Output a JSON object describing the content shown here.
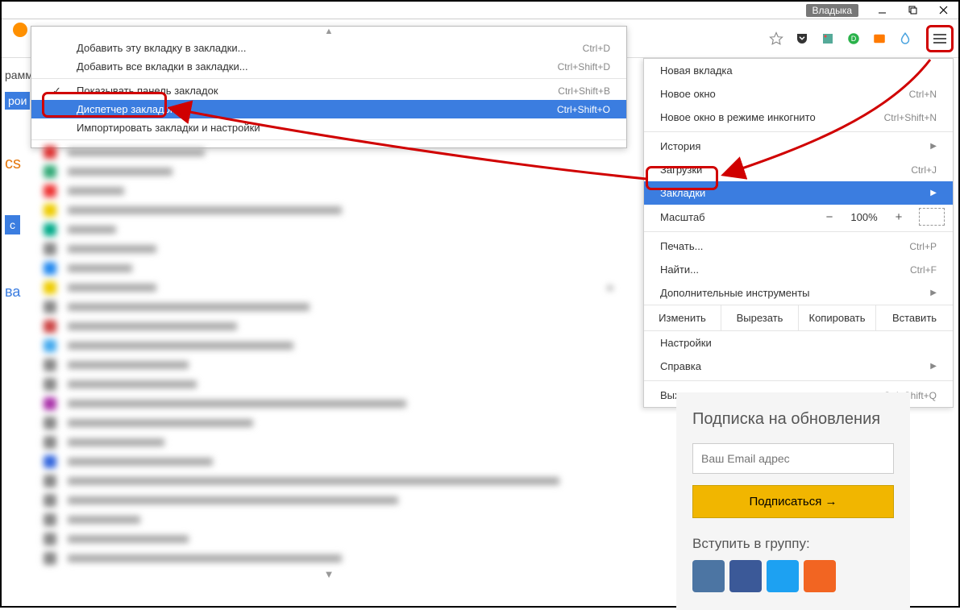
{
  "titlebar": {
    "user": "Владыка"
  },
  "main_menu": {
    "new_tab": "Новая вкладка",
    "new_window": "Новое окно",
    "new_window_sc": "Ctrl+N",
    "incognito": "Новое окно в режиме инкогнито",
    "incognito_sc": "Ctrl+Shift+N",
    "history": "История",
    "downloads": "Загрузки",
    "downloads_sc": "Ctrl+J",
    "bookmarks": "Закладки",
    "zoom": "Масштаб",
    "zoom_val": "100%",
    "print": "Печать...",
    "print_sc": "Ctrl+P",
    "find": "Найти...",
    "find_sc": "Ctrl+F",
    "more_tools": "Дополнительные инструменты",
    "edit": "Изменить",
    "cut": "Вырезать",
    "copy": "Копировать",
    "paste": "Вставить",
    "settings": "Настройки",
    "help": "Справка",
    "exit": "Выход",
    "exit_sc": "Ctrl+Shift+Q"
  },
  "sub_menu": {
    "add_this": "Добавить эту вкладку в закладки...",
    "add_this_sc": "Ctrl+D",
    "add_all": "Добавить все вкладки в закладки...",
    "add_all_sc": "Ctrl+Shift+D",
    "show_bar": "Показывать панель закладок",
    "show_bar_sc": "Ctrl+Shift+B",
    "manager": "Диспетчер закладок",
    "manager_sc": "Ctrl+Shift+O",
    "import": "Импортировать закладки и настройки"
  },
  "sidebar": {
    "title": "Подписка на обновления",
    "placeholder": "Ваш Email адрес",
    "button": "Подписаться →",
    "join": "Вступить в группу:"
  },
  "edge": {
    "cs": "cs",
    "c": "с",
    "va": "ва",
    "ram": "рамм",
    "roi": "рои"
  }
}
